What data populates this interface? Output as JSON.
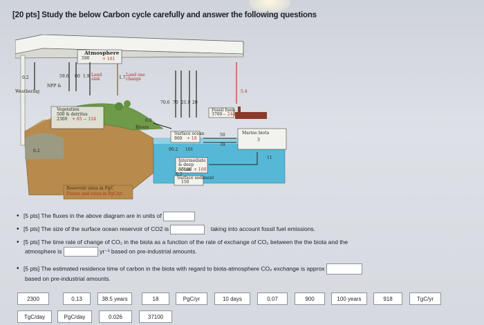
{
  "title": "[20 pts] Study the below Carbon cycle carefully and answer the following questions",
  "diagram": {
    "atmosphere": {
      "label": "Atmosphere",
      "value": "590",
      "change": "+ 161"
    },
    "left_flux_02": "0.2",
    "weathering": "Weathering",
    "flux_596": "59.6",
    "flux_60": "60",
    "flux_19": "1.9",
    "land_sink": "Land sink",
    "npp": "NPP &",
    "flux_17": "1.7",
    "land_use": "Land use change",
    "vegetation": "Vegetation",
    "veg_detail": "500 & detritus",
    "veg_value": "2300",
    "veg_change": "+ 65 − 124",
    "flux_08": "0.8",
    "rivers": "Rivers",
    "weathering_02": "0.2",
    "ocean_fluxes": [
      "70.6",
      "70",
      "21.9",
      "20"
    ],
    "fossil_flux": "5.4",
    "fossil_fuels": "Fossil fuels",
    "fossil_value": "3700",
    "fossil_change": "− 244",
    "surface_ocean": "Surface ocean",
    "surface_value": "900",
    "surface_change": "+ 18",
    "flux_50": "50",
    "flux_39": "39",
    "marine_biota": "Marine biota",
    "marine_value": "3",
    "flux_902": "90.2",
    "flux_101": "101",
    "flux_11": "11",
    "intermediate": "Intermediate & deep ocean",
    "deep_value": "37100",
    "deep_change": "+ 100",
    "flux_02b": "0.2",
    "sediment": "Surface sediment",
    "sediment_value": "150",
    "legend1": "Reservoir sizes in PgC",
    "legend2": "Fluxes and rates in PgC/yr"
  },
  "questions": {
    "q1": "[5 pts] The fluxes in the above diagram are in units of",
    "q2_a": "[5 pts] The size of the surface ocean reservoir of CO2 is",
    "q2_b": "taking into account fossil fuel emissions.",
    "q3_a": "[5 pts] The time rate of change of CO₂ in the biota as a function of the rate of exchange of CO₂ between the the biota and the",
    "q3_b1": "atmosphere is",
    "q3_b2": "yr⁻¹ based on pre-industrial amounts.",
    "q4_a": "[5 pts] The estimated residence time of carbon in the biota with regard to biota-atmosphere CO₂ exchange is approx",
    "q4_b": "based on pre-industrial amounts."
  },
  "options_row1": [
    "2300",
    "0.13",
    "38.5 years",
    "18",
    "PgC/yr",
    "10 days",
    "0.07",
    "900",
    "100 years",
    "918",
    "TgC/yr"
  ],
  "options_row2": [
    "TgC/day",
    "PgC/day",
    "0.026",
    "37100"
  ]
}
